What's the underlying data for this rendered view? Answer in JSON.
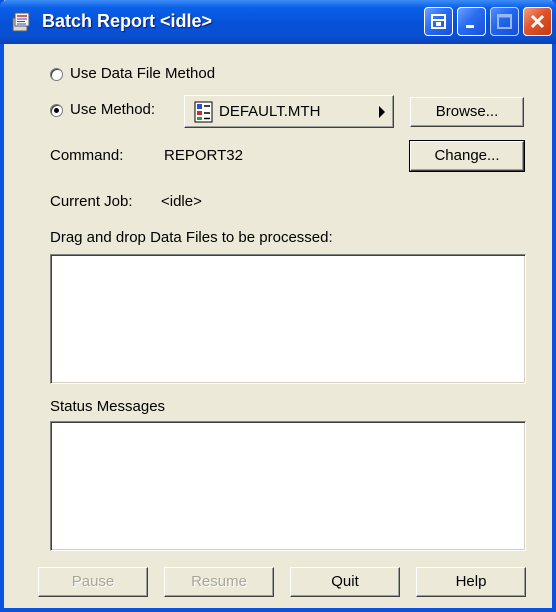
{
  "window": {
    "title": "Batch Report <idle>"
  },
  "options": {
    "use_data_file_method": "Use Data File Method",
    "use_method": "Use Method:",
    "selected": "use_method"
  },
  "method": {
    "name": "DEFAULT.MTH"
  },
  "buttons": {
    "browse": "Browse...",
    "change": "Change...",
    "pause": "Pause",
    "resume": "Resume",
    "quit": "Quit",
    "help": "Help"
  },
  "command": {
    "label": "Command:",
    "value": "REPORT32"
  },
  "current_job": {
    "label": "Current Job:",
    "value": "<idle>"
  },
  "drop_area": {
    "label": "Drag and drop Data Files to be processed:"
  },
  "status": {
    "label": "Status Messages"
  }
}
